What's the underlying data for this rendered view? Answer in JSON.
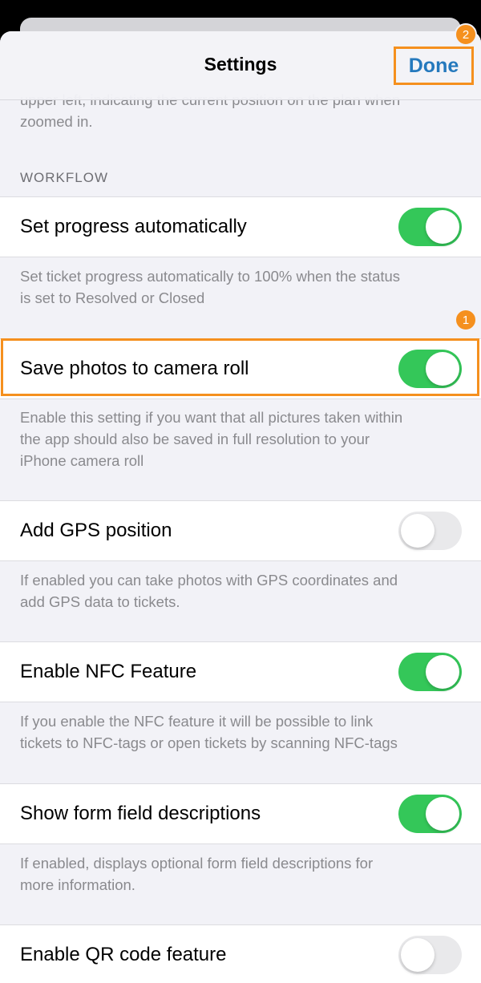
{
  "header": {
    "title": "Settings",
    "done_label": "Done",
    "done_badge": "2"
  },
  "intro_desc": {
    "line1": "upper left, indicating the current position on the plan when",
    "line2": "zoomed in."
  },
  "section": {
    "label": "WORKFLOW"
  },
  "settings": [
    {
      "label": "Set progress automatically",
      "enabled": true,
      "desc1": "Set ticket progress automatically to 100% when the status",
      "desc2": "is set to Resolved or Closed",
      "desc3": ""
    },
    {
      "label": "Save photos to camera roll",
      "enabled": true,
      "badge": "1",
      "desc1": "Enable this setting if you want that all pictures taken within",
      "desc2": "the app should also be saved in full resolution to your",
      "desc3": "iPhone camera roll"
    },
    {
      "label": "Add GPS position",
      "enabled": false,
      "desc1": "If enabled you can take photos with GPS coordinates and",
      "desc2": "add GPS data to tickets.",
      "desc3": ""
    },
    {
      "label": "Enable NFC Feature",
      "enabled": true,
      "desc1": "If you enable the NFC feature it will be possible to link",
      "desc2": "tickets to NFC-tags or open tickets by scanning NFC-tags",
      "desc3": ""
    },
    {
      "label": "Show form field descriptions",
      "enabled": true,
      "desc1": "If enabled, displays optional form field descriptions for",
      "desc2": "more information.",
      "desc3": ""
    },
    {
      "label": "Enable QR code feature",
      "enabled": false,
      "desc1": "",
      "desc2": "",
      "desc3": ""
    }
  ],
  "colors": {
    "accent": "#2579bd",
    "toggle_on": "#34c759",
    "toggle_off": "#e9e9eb",
    "highlight": "#f5901e"
  }
}
